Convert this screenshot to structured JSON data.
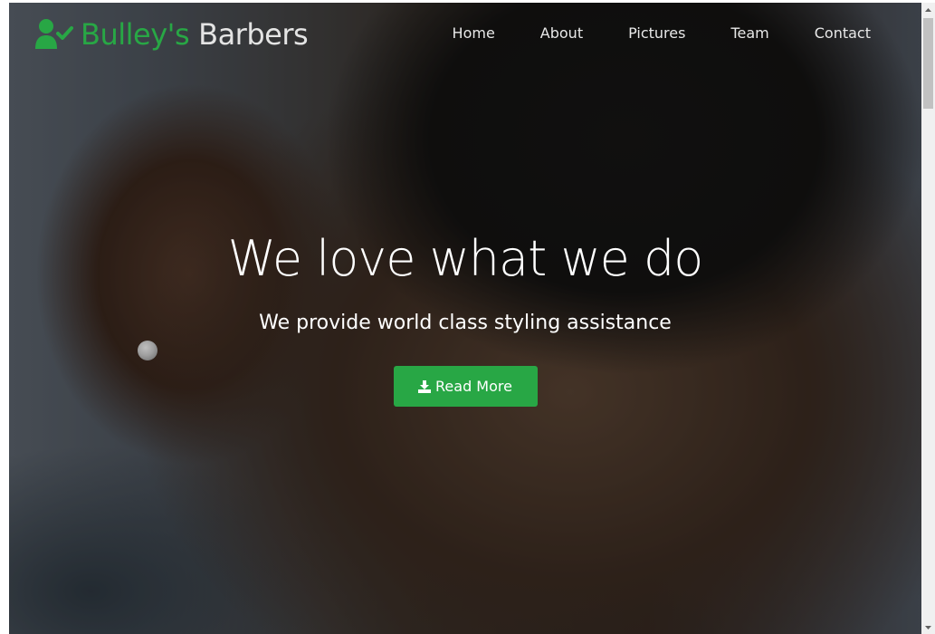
{
  "brand": {
    "name_part1": "Bulley's",
    "name_part2": "Barbers",
    "icon": "user-check-icon",
    "accent_color": "#28a745"
  },
  "nav": {
    "items": [
      {
        "label": "Home"
      },
      {
        "label": "About"
      },
      {
        "label": "Pictures"
      },
      {
        "label": "Team"
      },
      {
        "label": "Contact"
      }
    ]
  },
  "hero": {
    "title": "We love what we do",
    "subtitle": "We provide world class styling assistance",
    "button_label": "Read More",
    "button_icon": "download-icon"
  },
  "scrollbar": {
    "up_icon": "scroll-up-arrow-icon",
    "down_icon": "scroll-down-arrow-icon"
  }
}
